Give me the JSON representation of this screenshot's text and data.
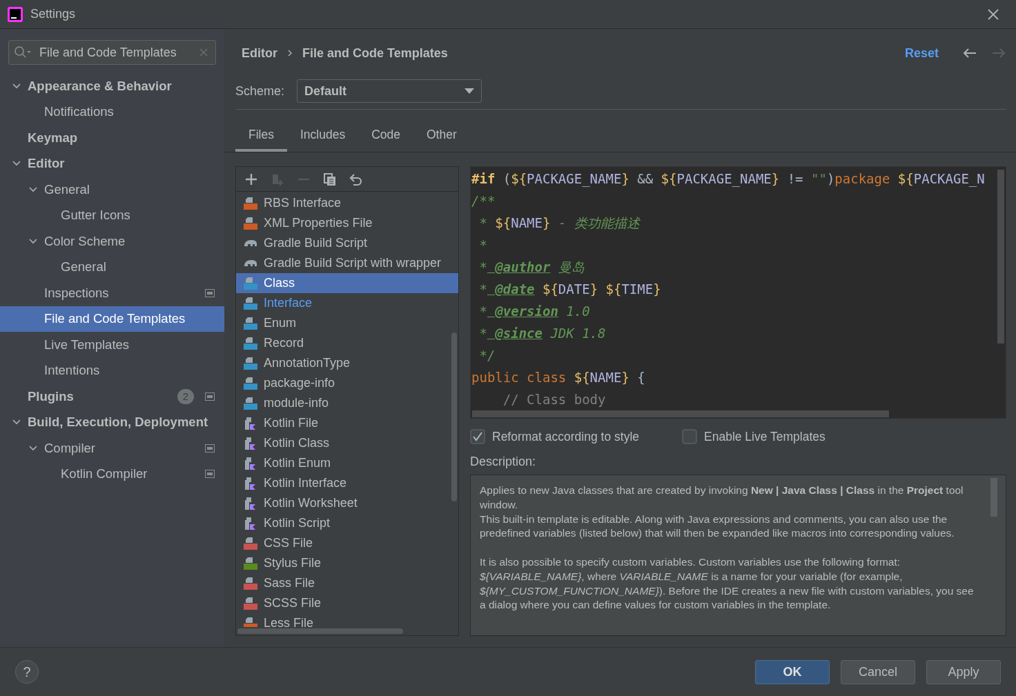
{
  "window": {
    "title": "Settings"
  },
  "sidebar": {
    "search": {
      "value": "File and Code Templates"
    },
    "items": [
      {
        "label": "Appearance & Behavior",
        "expanded": true,
        "selected": false,
        "children": [
          {
            "label": "Notifications",
            "selected": false
          }
        ]
      },
      {
        "label": "Keymap",
        "selected": false
      },
      {
        "label": "Editor",
        "expanded": true,
        "selected": false,
        "children": [
          {
            "label": "General",
            "expanded": true,
            "selected": false,
            "children": [
              {
                "label": "Gutter Icons",
                "selected": false
              }
            ]
          },
          {
            "label": "Color Scheme",
            "expanded": true,
            "selected": false,
            "children": [
              {
                "label": "General",
                "selected": false
              }
            ]
          },
          {
            "label": "Inspections",
            "selected": false,
            "project_scope": true
          },
          {
            "label": "File and Code Templates",
            "selected": true
          },
          {
            "label": "Live Templates",
            "selected": false
          },
          {
            "label": "Intentions",
            "selected": false
          }
        ]
      },
      {
        "label": "Plugins",
        "selected": false,
        "badge": "2",
        "project_scope": true
      },
      {
        "label": "Build, Execution, Deployment",
        "expanded": true,
        "selected": false,
        "children": [
          {
            "label": "Compiler",
            "expanded": true,
            "selected": false,
            "project_scope": true,
            "children": [
              {
                "label": "Kotlin Compiler",
                "selected": false,
                "project_scope": true
              }
            ]
          }
        ]
      }
    ]
  },
  "header": {
    "breadcrumbs": [
      "Editor",
      "File and Code Templates"
    ],
    "reset": "Reset",
    "nav": [
      {
        "kind": "back",
        "disabled": false
      },
      {
        "kind": "forward",
        "disabled": true
      }
    ]
  },
  "scheme": {
    "label": "Scheme:",
    "value": "Default"
  },
  "tabs": [
    {
      "label": "Files",
      "selected": true
    },
    {
      "label": "Includes",
      "selected": false
    },
    {
      "label": "Code",
      "selected": false
    },
    {
      "label": "Other",
      "selected": false
    }
  ],
  "toolbar": [
    {
      "kind": "add",
      "disabled": false
    },
    {
      "kind": "add-child",
      "disabled": true
    },
    {
      "kind": "remove",
      "disabled": true
    },
    {
      "kind": "copy",
      "disabled": false
    },
    {
      "kind": "reset",
      "disabled": false
    }
  ],
  "templates": [
    {
      "label": "RBS Interface",
      "kind": "rbs",
      "selected": false,
      "modified": false
    },
    {
      "label": "XML Properties File",
      "kind": "xml",
      "selected": false,
      "modified": false
    },
    {
      "label": "Gradle Build Script",
      "kind": "gradle",
      "selected": false,
      "modified": false
    },
    {
      "label": "Gradle Build Script with wrapper",
      "kind": "gradle",
      "selected": false,
      "modified": false
    },
    {
      "label": "Class",
      "kind": "java",
      "selected": true,
      "modified": false
    },
    {
      "label": "Interface",
      "kind": "java",
      "selected": false,
      "modified": true
    },
    {
      "label": "Enum",
      "kind": "java",
      "selected": false,
      "modified": false
    },
    {
      "label": "Record",
      "kind": "java",
      "selected": false,
      "modified": false
    },
    {
      "label": "AnnotationType",
      "kind": "java",
      "selected": false,
      "modified": false
    },
    {
      "label": "package-info",
      "kind": "java",
      "selected": false,
      "modified": false
    },
    {
      "label": "module-info",
      "kind": "java",
      "selected": false,
      "modified": false
    },
    {
      "label": "Kotlin File",
      "kind": "kotlin",
      "selected": false,
      "modified": false
    },
    {
      "label": "Kotlin Class",
      "kind": "kotlin",
      "selected": false,
      "modified": false
    },
    {
      "label": "Kotlin Enum",
      "kind": "kotlin",
      "selected": false,
      "modified": false
    },
    {
      "label": "Kotlin Interface",
      "kind": "kotlin",
      "selected": false,
      "modified": false
    },
    {
      "label": "Kotlin Worksheet",
      "kind": "kotlin",
      "selected": false,
      "modified": false
    },
    {
      "label": "Kotlin Script",
      "kind": "kotlin",
      "selected": false,
      "modified": false
    },
    {
      "label": "CSS File",
      "kind": "css",
      "selected": false,
      "modified": false
    },
    {
      "label": "Stylus File",
      "kind": "styl",
      "selected": false,
      "modified": false
    },
    {
      "label": "Sass File",
      "kind": "sass",
      "selected": false,
      "modified": false
    },
    {
      "label": "SCSS File",
      "kind": "sass",
      "selected": false,
      "modified": false
    },
    {
      "label": "Less File",
      "kind": "less",
      "selected": false,
      "modified": false
    }
  ],
  "code": [
    [
      {
        "kind": "directive",
        "text": "#if"
      },
      {
        "kind": "plain",
        "text": " ("
      },
      {
        "kind": "brace",
        "text": "${"
      },
      {
        "kind": "var",
        "text": "PACKAGE_NAME"
      },
      {
        "kind": "brace",
        "text": "}"
      },
      {
        "kind": "plain",
        "text": " && "
      },
      {
        "kind": "brace",
        "text": "${"
      },
      {
        "kind": "var",
        "text": "PACKAGE_NAME"
      },
      {
        "kind": "brace",
        "text": "}"
      },
      {
        "kind": "plain",
        "text": " != "
      },
      {
        "kind": "string",
        "text": "\"\""
      },
      {
        "kind": "plain",
        "text": ")"
      },
      {
        "kind": "keyword",
        "text": "package"
      },
      {
        "kind": "brace",
        "text": " ${"
      },
      {
        "kind": "var",
        "text": "PACKAGE_N"
      }
    ],
    [
      {
        "kind": "doc",
        "text": "/**"
      }
    ],
    [
      {
        "kind": "doc",
        "text": " *"
      },
      {
        "kind": "brace",
        "text": " ${"
      },
      {
        "kind": "var",
        "text": "NAME"
      },
      {
        "kind": "brace",
        "text": "}"
      },
      {
        "kind": "doc",
        "text": " - 类功能描述"
      }
    ],
    [
      {
        "kind": "doc",
        "text": " *"
      }
    ],
    [
      {
        "kind": "doc",
        "text": " *"
      },
      {
        "kind": "tag",
        "text": " @author"
      },
      {
        "kind": "doc",
        "text": " 曼岛"
      }
    ],
    [
      {
        "kind": "doc",
        "text": " *"
      },
      {
        "kind": "tag",
        "text": " @date"
      },
      {
        "kind": "brace",
        "text": " ${"
      },
      {
        "kind": "var",
        "text": "DATE"
      },
      {
        "kind": "brace",
        "text": "} ${"
      },
      {
        "kind": "var",
        "text": "TIME"
      },
      {
        "kind": "brace",
        "text": "}"
      }
    ],
    [
      {
        "kind": "doc",
        "text": " *"
      },
      {
        "kind": "tag",
        "text": " @version"
      },
      {
        "kind": "doc",
        "text": " 1.0"
      }
    ],
    [
      {
        "kind": "doc",
        "text": " *"
      },
      {
        "kind": "tag",
        "text": " @since"
      },
      {
        "kind": "doc",
        "text": " JDK 1.8"
      }
    ],
    [
      {
        "kind": "doc",
        "text": " */"
      }
    ],
    [
      {
        "kind": "keyword",
        "text": "public class"
      },
      {
        "kind": "brace",
        "text": " ${"
      },
      {
        "kind": "var",
        "text": "NAME"
      },
      {
        "kind": "brace",
        "text": "}"
      },
      {
        "kind": "plain",
        "text": " {"
      }
    ],
    [
      {
        "kind": "comment",
        "text": "    // Class body"
      }
    ]
  ],
  "options": [
    {
      "label": "Reformat according to style",
      "checked": true
    },
    {
      "label": "Enable Live Templates",
      "checked": false
    }
  ],
  "description": {
    "label": "Description:",
    "sections": [
      [
        "Applies to new Java classes that are created by invoking **New | Java Class | Class** in the **Project** tool window.",
        "This built-in template is editable. Along with Java expressions and comments, you can also use the predefined variables (listed below) that will then be expanded like macros into corresponding values."
      ],
      [
        "It is also possible to specify custom variables. Custom variables use the following format: *${VARIABLE_NAME}*, where *VARIABLE_NAME* is a name for your variable (for example, *${MY_CUSTOM_FUNCTION_NAME}*). Before the IDE creates a new file with custom variables, you see a dialog where you can define values for custom variables in the template."
      ]
    ]
  },
  "footer": {
    "help": "?",
    "buttons": [
      {
        "label": "OK",
        "default": true
      },
      {
        "label": "Cancel",
        "default": false
      },
      {
        "label": "Apply",
        "default": false
      }
    ]
  }
}
